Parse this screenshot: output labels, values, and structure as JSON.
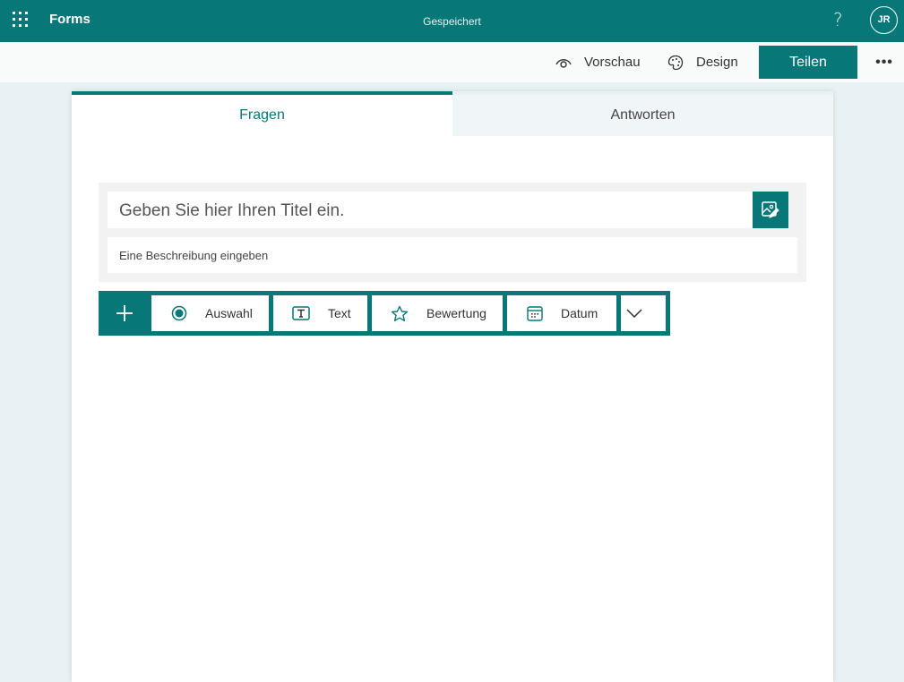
{
  "topbar": {
    "app_name": "Forms",
    "status": "Gespeichert",
    "help": "?",
    "avatar_initials": "JR",
    "brand_color": "#077777"
  },
  "commandbar": {
    "preview_label": "Vorschau",
    "design_label": "Design",
    "share_label": "Teilen",
    "more_label": "•••"
  },
  "tabs": [
    {
      "label": "Fragen",
      "active": true
    },
    {
      "label": "Antworten",
      "active": false
    }
  ],
  "form": {
    "title_placeholder": "Geben Sie hier Ihren Titel ein.",
    "description_placeholder": "Eine Beschreibung eingeben"
  },
  "question_types": [
    {
      "label": "Auswahl",
      "icon": "radio-icon"
    },
    {
      "label": "Text",
      "icon": "text-icon"
    },
    {
      "label": "Bewertung",
      "icon": "star-icon"
    },
    {
      "label": "Datum",
      "icon": "calendar-icon"
    }
  ]
}
